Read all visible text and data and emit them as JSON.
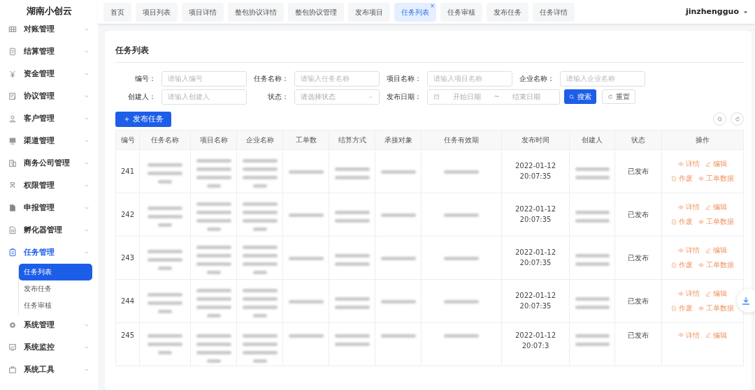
{
  "app_title": "湖南小创云",
  "sidebar": {
    "items": [
      {
        "label": "对账管理",
        "expanded": false
      },
      {
        "label": "结算管理",
        "expanded": false
      },
      {
        "label": "资金管理",
        "expanded": false
      },
      {
        "label": "协议管理",
        "expanded": false
      },
      {
        "label": "客户管理",
        "expanded": false
      },
      {
        "label": "渠道管理",
        "expanded": false
      },
      {
        "label": "商务公司管理",
        "expanded": false
      },
      {
        "label": "权限管理",
        "expanded": false
      },
      {
        "label": "申报管理",
        "expanded": false
      },
      {
        "label": "孵化器管理",
        "expanded": false
      },
      {
        "label": "任务管理",
        "expanded": true,
        "children": [
          {
            "label": "任务列表",
            "selected": true
          },
          {
            "label": "发布任务",
            "selected": false
          },
          {
            "label": "任务审核",
            "selected": false
          }
        ]
      },
      {
        "label": "系统管理",
        "expanded": false
      },
      {
        "label": "系统监控",
        "expanded": false
      },
      {
        "label": "系统工具",
        "expanded": false
      }
    ]
  },
  "tabs": [
    {
      "label": "首页",
      "selected": false
    },
    {
      "label": "项目列表",
      "selected": false
    },
    {
      "label": "项目详情",
      "selected": false
    },
    {
      "label": "整包协议详情",
      "selected": false
    },
    {
      "label": "整包协议管理",
      "selected": false
    },
    {
      "label": "发布项目",
      "selected": false
    },
    {
      "label": "任务列表",
      "selected": true,
      "close": "×"
    },
    {
      "label": "任务审核",
      "selected": false
    },
    {
      "label": "发布任务",
      "selected": false
    },
    {
      "label": "任务详情",
      "selected": false
    }
  ],
  "user": "jinzhengguo",
  "page_title": "任务列表",
  "filters": [
    {
      "label": "编号：",
      "kind": "input",
      "placeholder": "请输入编号"
    },
    {
      "label": "任务名称：",
      "kind": "input",
      "placeholder": "请输入任务名称"
    },
    {
      "label": "项目名称：",
      "kind": "input",
      "placeholder": "请输入项目名称"
    },
    {
      "label": "企业名称：",
      "kind": "input",
      "placeholder": "请输入企业名称"
    },
    {
      "label": "创建人：",
      "kind": "input",
      "placeholder": "请输入创建人"
    },
    {
      "label": "状态：",
      "kind": "select",
      "placeholder": "请选择状态"
    },
    {
      "label": "发布日期：",
      "kind": "daterange",
      "start_placeholder": "开始日期",
      "separator": "~",
      "end_placeholder": "结束日期"
    }
  ],
  "search_button": "搜索",
  "reset_button": "重置",
  "add_button": "＋ 发布任务",
  "table": {
    "columns": [
      {
        "label": "编号",
        "kind": "text"
      },
      {
        "label": "任务名称",
        "kind": "blur3"
      },
      {
        "label": "项目名称",
        "kind": "blur4"
      },
      {
        "label": "企业名称",
        "kind": "blur4"
      },
      {
        "label": "工单数",
        "kind": "blur1"
      },
      {
        "label": "结算方式",
        "kind": "blur2"
      },
      {
        "label": "承接对象",
        "kind": "blur1"
      },
      {
        "label": "任务有效期",
        "kind": "blur1"
      },
      {
        "label": "发布时间",
        "kind": "text"
      },
      {
        "label": "创建人",
        "kind": "blur2"
      },
      {
        "label": "状态",
        "kind": "text"
      },
      {
        "label": "操作",
        "kind": "actions"
      }
    ],
    "rows": [
      {
        "id": "241",
        "published": "2022-01-12 20:07:35",
        "status": "已发布",
        "actions": [
          "详情",
          "编辑",
          "作废",
          "工单数据"
        ]
      },
      {
        "id": "242",
        "published": "2022-01-12 20:07:35",
        "status": "已发布",
        "actions": [
          "详情",
          "编辑",
          "作废",
          "工单数据"
        ]
      },
      {
        "id": "243",
        "published": "2022-01-12 20:07:35",
        "status": "已发布",
        "actions": [
          "详情",
          "编辑",
          "作废",
          "工单数据"
        ]
      },
      {
        "id": "244",
        "published": "2022-01-12 20:07:35",
        "status": "已发布",
        "actions": [
          "详情",
          "编辑",
          "作废",
          "工单数据"
        ]
      },
      {
        "id": "245",
        "published": "2022-01-12 20:07:3",
        "status": "已发布",
        "actions": [
          "详情",
          "编辑"
        ]
      }
    ]
  }
}
